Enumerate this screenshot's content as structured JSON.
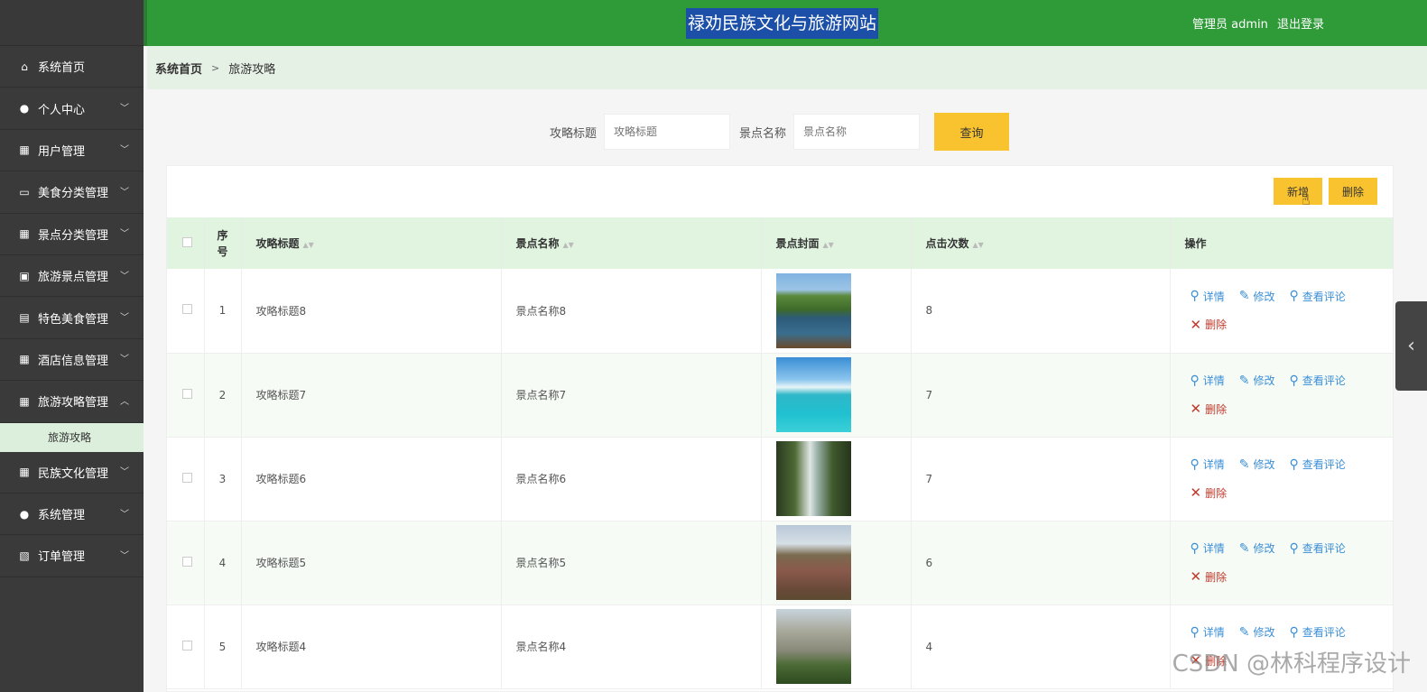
{
  "header": {
    "title": "禄劝民族文化与旅游网站",
    "admin_label": "管理员 admin",
    "logout": "退出登录"
  },
  "sidebar": {
    "items": [
      {
        "label": "系统首页",
        "icon": "home-icon"
      },
      {
        "label": "个人中心",
        "icon": "user-icon"
      },
      {
        "label": "用户管理",
        "icon": "grid-icon"
      },
      {
        "label": "美食分类管理",
        "icon": "monitor-icon"
      },
      {
        "label": "景点分类管理",
        "icon": "grid-icon"
      },
      {
        "label": "旅游景点管理",
        "icon": "briefcase-icon"
      },
      {
        "label": "特色美食管理",
        "icon": "printer-icon"
      },
      {
        "label": "酒店信息管理",
        "icon": "grid-icon"
      },
      {
        "label": "旅游攻略管理",
        "icon": "grid-icon"
      },
      {
        "label": "民族文化管理",
        "icon": "grid-icon"
      },
      {
        "label": "系统管理",
        "icon": "user-icon"
      },
      {
        "label": "订单管理",
        "icon": "clipboard-icon"
      }
    ],
    "sub_item": "旅游攻略"
  },
  "breadcrumb": {
    "home": "系统首页",
    "sep": ">",
    "current": "旅游攻略"
  },
  "search": {
    "title_label": "攻略标题",
    "title_placeholder": "攻略标题",
    "spot_label": "景点名称",
    "spot_placeholder": "景点名称",
    "button": "查询"
  },
  "toolbar": {
    "add": "新增",
    "delete": "删除"
  },
  "table": {
    "headers": {
      "no": "序号",
      "title": "攻略标题",
      "spot": "景点名称",
      "cover": "景点封面",
      "clicks": "点击次数",
      "ops": "操作"
    },
    "ops": {
      "detail": "详情",
      "edit": "修改",
      "comments": "查看评论",
      "delete": "删除"
    },
    "rows": [
      {
        "no": "1",
        "title": "攻略标题8",
        "spot": "景点名称8",
        "clicks": "8"
      },
      {
        "no": "2",
        "title": "攻略标题7",
        "spot": "景点名称7",
        "clicks": "7"
      },
      {
        "no": "3",
        "title": "攻略标题6",
        "spot": "景点名称6",
        "clicks": "7"
      },
      {
        "no": "4",
        "title": "攻略标题5",
        "spot": "景点名称5",
        "clicks": "6"
      },
      {
        "no": "5",
        "title": "攻略标题4",
        "spot": "景点名称4",
        "clicks": "4"
      }
    ]
  },
  "watermark": "CSDN @林科程序设计",
  "colors": {
    "header": "#2f9a38",
    "accent": "#f9c330",
    "sidebar": "#3a3a3a",
    "link": "#3b8fd6",
    "danger": "#c0392b"
  }
}
